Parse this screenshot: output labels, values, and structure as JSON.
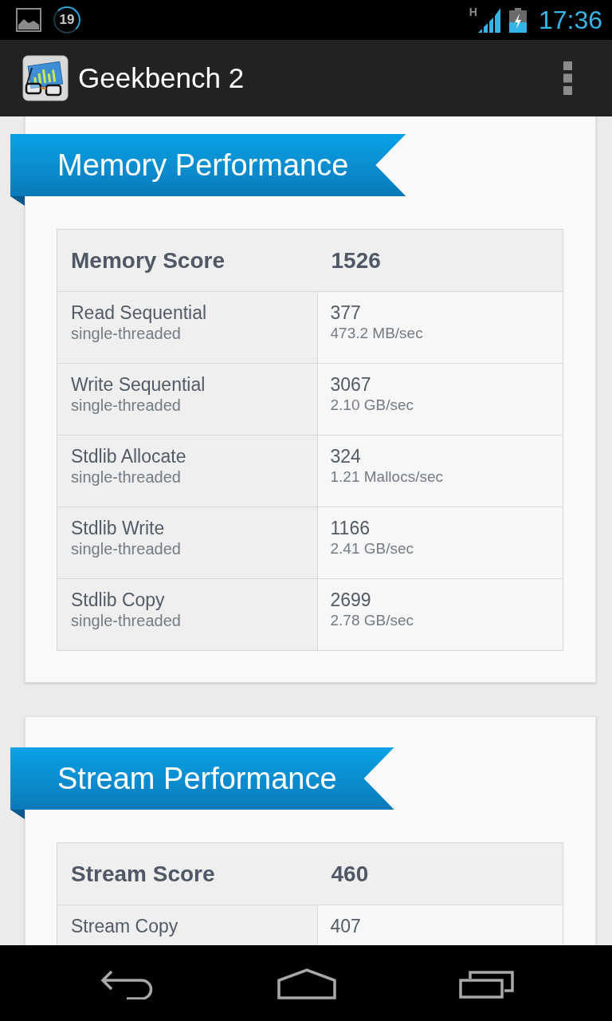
{
  "status_bar": {
    "notification_count": "19",
    "network_type": "H",
    "time": "17:36"
  },
  "action_bar": {
    "title": "Geekbench 2"
  },
  "sections": [
    {
      "title": "Memory Performance",
      "score": {
        "label": "Memory Score",
        "value": "1526"
      },
      "rows": [
        {
          "name": "Read Sequential",
          "mode": "single-threaded",
          "score": "377",
          "rate": "473.2 MB/sec"
        },
        {
          "name": "Write Sequential",
          "mode": "single-threaded",
          "score": "3067",
          "rate": "2.10 GB/sec"
        },
        {
          "name": "Stdlib Allocate",
          "mode": "single-threaded",
          "score": "324",
          "rate": "1.21 Mallocs/sec"
        },
        {
          "name": "Stdlib Write",
          "mode": "single-threaded",
          "score": "1166",
          "rate": "2.41 GB/sec"
        },
        {
          "name": "Stdlib Copy",
          "mode": "single-threaded",
          "score": "2699",
          "rate": "2.78 GB/sec"
        }
      ]
    },
    {
      "title": "Stream Performance",
      "score": {
        "label": "Stream Score",
        "value": "460"
      },
      "rows": [
        {
          "name": "Stream Copy",
          "score": "407"
        }
      ]
    }
  ]
}
